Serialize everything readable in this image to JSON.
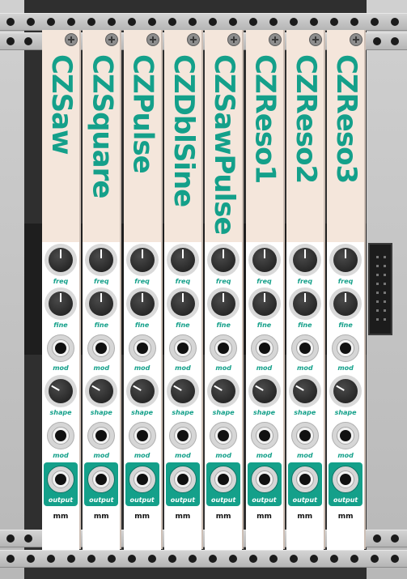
{
  "modules": [
    {
      "title": "CZSaw"
    },
    {
      "title": "CZSquare"
    },
    {
      "title": "CZPulse"
    },
    {
      "title": "CZDblSine"
    },
    {
      "title": "CZSawPulse"
    },
    {
      "title": "CZReso1"
    },
    {
      "title": "CZReso2"
    },
    {
      "title": "CZReso3"
    }
  ],
  "labels": {
    "freq": "freq",
    "fine": "fine",
    "mod": "mod",
    "shape": "shape",
    "output": "output",
    "brand": "mm"
  },
  "colors": {
    "accent": "#14a08a",
    "panel": "#f4e6db",
    "rack": "#2b2b2b",
    "rail": "#c4c4c4"
  }
}
